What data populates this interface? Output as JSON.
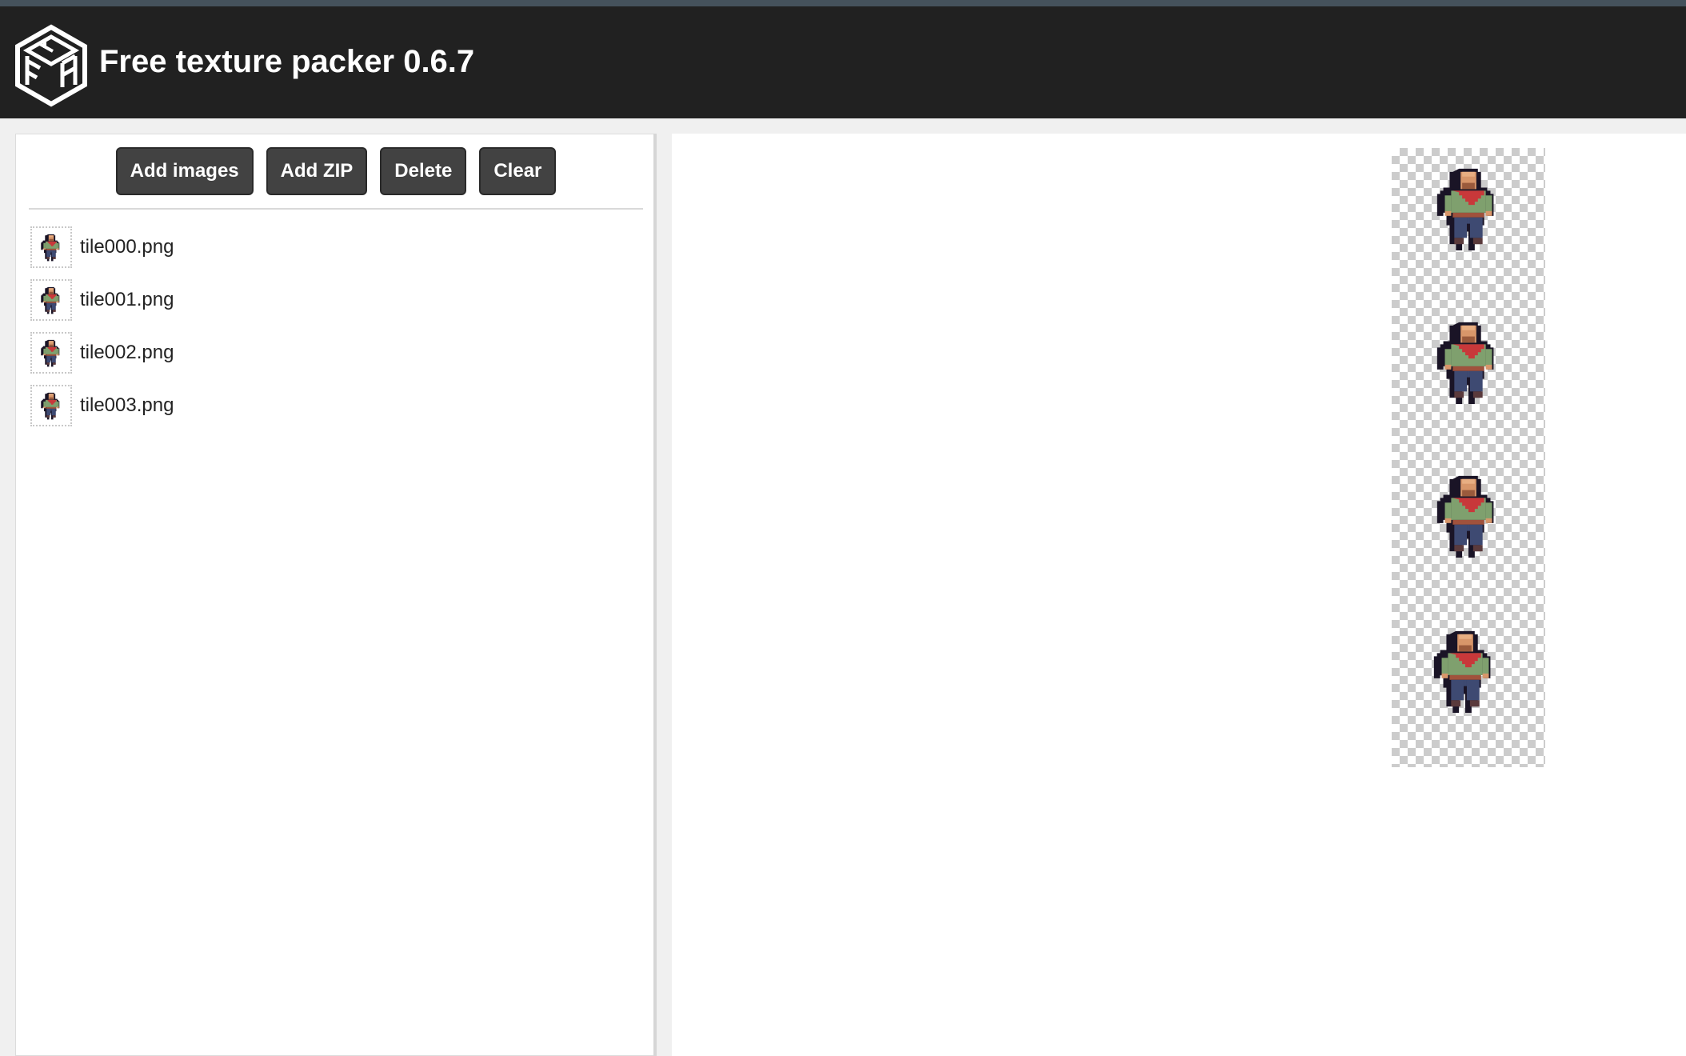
{
  "app": {
    "title": "Free texture packer 0.6.7",
    "logo_icon": "ftp-hexagon-logo-icon"
  },
  "colors": {
    "header_bg": "#212121",
    "button_bg": "#424242",
    "panel_bg": "#ffffff",
    "page_bg": "#f0f0f0"
  },
  "toolbar": {
    "add_images_label": "Add images",
    "add_zip_label": "Add ZIP",
    "delete_label": "Delete",
    "clear_label": "Clear"
  },
  "files": [
    {
      "name": "tile000.png",
      "icon": "character-sprite-icon"
    },
    {
      "name": "tile001.png",
      "icon": "character-sprite-icon"
    },
    {
      "name": "tile002.png",
      "icon": "character-sprite-icon"
    },
    {
      "name": "tile003.png",
      "icon": "character-sprite-icon"
    }
  ],
  "preview": {
    "sprite_count": 4,
    "background": "transparent-checkerboard"
  }
}
